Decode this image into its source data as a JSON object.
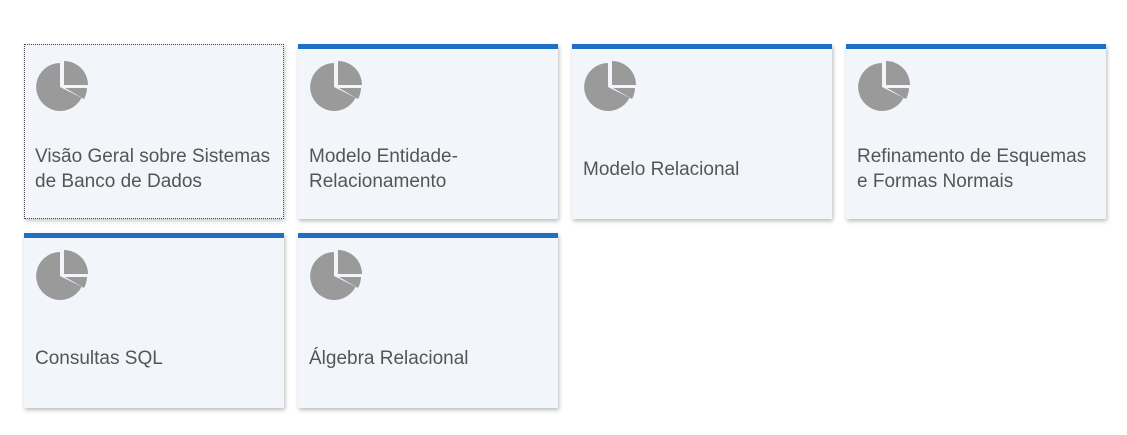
{
  "theme": {
    "accent": "#1f6fc5",
    "tile_background": "#f2f6fa",
    "icon_color": "#9a9a9a",
    "text_color": "#555555"
  },
  "tiles": [
    {
      "icon": "pie-chart-icon",
      "label": "Visão Geral sobre Sistemas de Banco de Dados"
    },
    {
      "icon": "pie-chart-icon",
      "label": "Modelo Entidade-Relacionamento"
    },
    {
      "icon": "pie-chart-icon",
      "label": "Modelo Relacional"
    },
    {
      "icon": "pie-chart-icon",
      "label": "Refinamento de Esquemas e Formas Normais"
    },
    {
      "icon": "pie-chart-icon",
      "label": "Consultas SQL"
    },
    {
      "icon": "pie-chart-icon",
      "label": "Álgebra Relacional"
    }
  ]
}
